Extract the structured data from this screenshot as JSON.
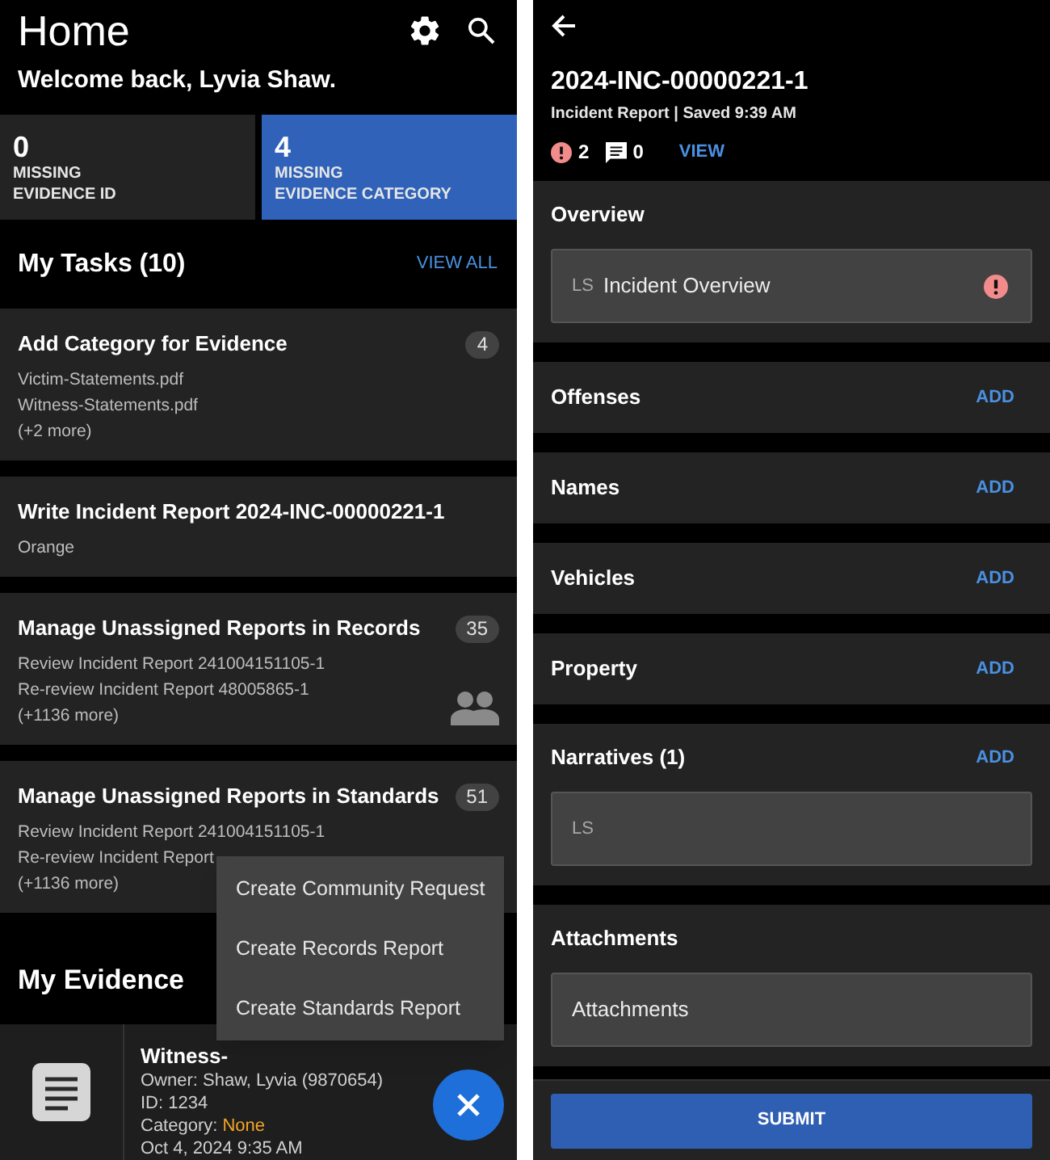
{
  "home": {
    "title": "Home",
    "welcome": "Welcome back, Lyvia Shaw.",
    "stats": [
      {
        "value": "0",
        "label_lines": [
          "MISSING",
          "EVIDENCE ID"
        ],
        "selected": false
      },
      {
        "value": "4",
        "label_lines": [
          "MISSING",
          "EVIDENCE CATEGORY"
        ],
        "selected": true
      }
    ],
    "tasks_header": {
      "title": "My Tasks (10)",
      "action": "VIEW ALL"
    },
    "tasks": [
      {
        "title": "Add Category for Evidence",
        "count": "4",
        "lines": [
          "Victim-Statements.pdf",
          "Witness-Statements.pdf",
          "(+2 more)"
        ],
        "group": false
      },
      {
        "title": "Write Incident Report 2024-INC-00000221-1",
        "lines": [
          "Orange"
        ],
        "group": false
      },
      {
        "title": "Manage Unassigned Reports in Records",
        "count": "35",
        "lines": [
          "Review Incident Report 241004151105-1",
          "Re-review Incident Report 48005865-1",
          "(+1136 more)"
        ],
        "group": true
      },
      {
        "title": "Manage Unassigned Reports in Standards",
        "count": "51",
        "lines": [
          "Review Incident Report 241004151105-1",
          "Re-review Incident Report",
          "(+1136 more)"
        ],
        "group": false
      }
    ],
    "evidence_header": {
      "title": "My Evidence"
    },
    "evidence": [
      {
        "title": "Witness-",
        "owner": "Owner: Shaw, Lyvia (9870654)",
        "id": "ID: 1234",
        "category_label": "Category:",
        "category_value": "None",
        "date": "Oct 4, 2024 9:35 AM"
      }
    ],
    "menu": [
      "Create Community Request",
      "Create Records Report",
      "Create Standards Report"
    ]
  },
  "report": {
    "title": "2024-INC-00000221-1",
    "subtitle": "Incident Report | Saved 9:39 AM",
    "error_count": "2",
    "comment_count": "0",
    "view": "VIEW",
    "sections": [
      {
        "title": "Overview",
        "field": {
          "initials": "LS",
          "text": "Incident Overview",
          "error": true
        }
      },
      {
        "title": "Offenses",
        "action": "ADD"
      },
      {
        "title": "Names",
        "action": "ADD"
      },
      {
        "title": "Vehicles",
        "action": "ADD"
      },
      {
        "title": "Property",
        "action": "ADD"
      },
      {
        "title": "Narratives (1)",
        "action": "ADD",
        "field": {
          "initials": "LS",
          "error": false
        }
      },
      {
        "title": "Attachments",
        "field": {
          "text": "Attachments",
          "error": false
        }
      }
    ],
    "submit": "SUBMIT"
  }
}
